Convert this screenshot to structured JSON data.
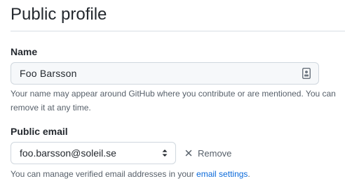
{
  "page": {
    "title": "Public profile"
  },
  "name_field": {
    "label": "Name",
    "value": "Foo Barsson",
    "icon": "contact-card-icon",
    "note": "Your name may appear around GitHub where you contribute or are mentioned. You can remove it at any time."
  },
  "email_field": {
    "label": "Public email",
    "selected": "foo.barsson@soleil.se",
    "arrow_icon": "select-arrows-icon",
    "remove_label": "Remove",
    "remove_icon": "x-icon",
    "note_prefix": "You can manage verified email addresses in your ",
    "note_link": "email settings",
    "note_suffix": "."
  },
  "colors": {
    "text": "#24292f",
    "muted": "#57606a",
    "link": "#0969da",
    "border": "#d0d7de",
    "input_bg": "#f6f8fa"
  }
}
